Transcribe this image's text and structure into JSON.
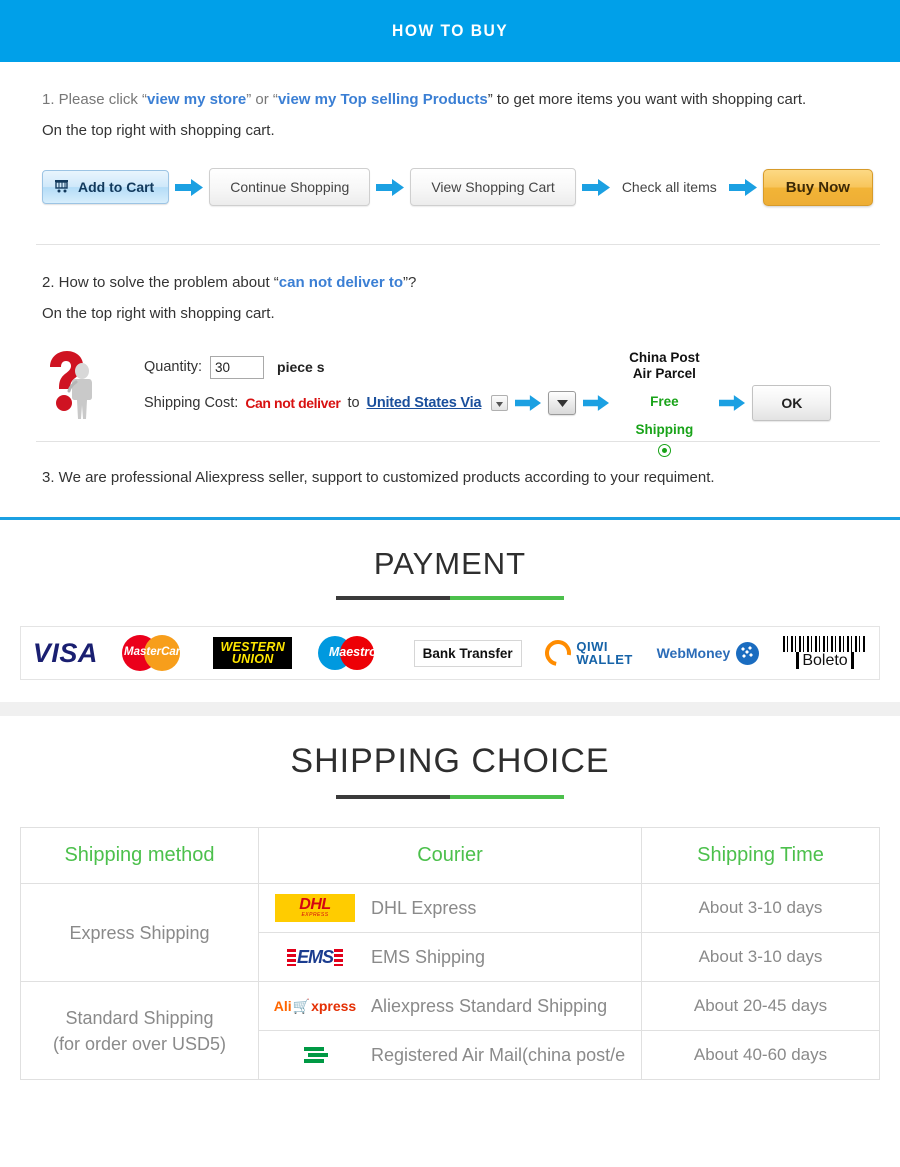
{
  "howto": {
    "header_title": "HOW TO BUY",
    "step1": {
      "line1_pre": "1. Please click “",
      "link1": "view my store",
      "mid": "” or “",
      "link2": "view my Top selling Products",
      "line1_post": "” to get more items you want with shopping cart.",
      "line2": "On the top right with shopping cart."
    },
    "flow": {
      "add_to_cart": "Add to Cart",
      "continue_shopping": "Continue Shopping",
      "view_shopping_cart": "View Shopping Cart",
      "check_all_items": "Check all items",
      "buy_now": "Buy Now"
    },
    "step2": {
      "line1_pre": "2. How to solve the problem about “",
      "link": "can not deliver to",
      "line1_post": "”?",
      "line2": "On the top right with shopping cart."
    },
    "calc": {
      "quantity_label": "Quantity:",
      "quantity_value": "30",
      "piece_label": "piece s",
      "shipping_cost_label": "Shipping Cost:",
      "cannot_deliver": "Can not deliver",
      "to_label": "to",
      "country": "United States Via",
      "service_line1": "China Post",
      "service_line2": "Air Parcel",
      "free_line1": "Free",
      "free_line2": "Shipping",
      "ok_button": "OK"
    },
    "step3": "3. We are professional Aliexpress seller, support to customized products according to your requiment."
  },
  "payment": {
    "title": "PAYMENT",
    "methods": [
      {
        "name": "visa",
        "label": "VISA"
      },
      {
        "name": "mastercard",
        "label": "MasterCard"
      },
      {
        "name": "western-union",
        "line1": "WESTERN",
        "line2": "UNION"
      },
      {
        "name": "maestro",
        "label": "Maestro"
      },
      {
        "name": "bank-transfer",
        "label": "Bank Transfer"
      },
      {
        "name": "qiwi-wallet",
        "line1": "QIWI",
        "line2": "WALLET"
      },
      {
        "name": "webmoney",
        "label": "WebMoney"
      },
      {
        "name": "boleto",
        "label": "Boleto"
      }
    ]
  },
  "shipping": {
    "title": "SHIPPING CHOICE",
    "headers": {
      "method": "Shipping method",
      "courier": "Courier",
      "time": "Shipping Time"
    },
    "groups": [
      {
        "method": "Express Shipping",
        "rows": [
          {
            "logo": "dhl",
            "courier": "DHL Express",
            "time": "About 3-10 days"
          },
          {
            "logo": "ems",
            "courier": "EMS Shipping",
            "time": "About 3-10 days"
          }
        ]
      },
      {
        "method_line1": "Standard Shipping",
        "method_line2": "(for order over USD5)",
        "rows": [
          {
            "logo": "aliexpress",
            "courier": "Aliexpress Standard Shipping",
            "time": "About 20-45 days"
          },
          {
            "logo": "china-post",
            "courier": "Registered Air Mail(china post/e",
            "time": "About 40-60 days"
          }
        ]
      }
    ]
  },
  "colors": {
    "header_blue": "#00a0e9",
    "link_blue": "#3b7fd4",
    "accent_green": "#4cc04c",
    "alert_red": "#d81111"
  }
}
